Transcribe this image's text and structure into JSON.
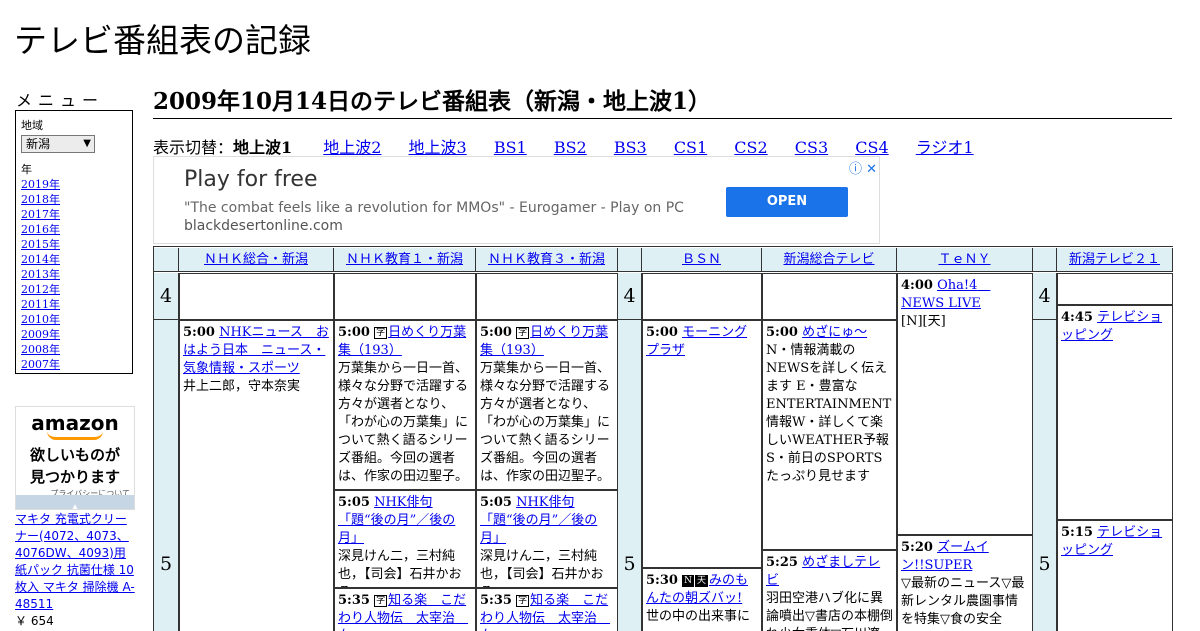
{
  "site_title": "テレビ番組表の記録",
  "menu": {
    "title": "メニュー",
    "region_label": "地域",
    "region_value": "新潟",
    "year_label": "年",
    "years": [
      "2019年",
      "2018年",
      "2017年",
      "2016年",
      "2015年",
      "2014年",
      "2013年",
      "2012年",
      "2011年",
      "2010年",
      "2009年",
      "2008年",
      "2007年"
    ]
  },
  "amazon_ad": {
    "logo": "amazon",
    "tagline_1": "欲しいものが",
    "tagline_2": "見つかります",
    "privacy": "プライバシーについて"
  },
  "product": {
    "text": "マキタ 充電式クリーナー(4072、4073、4076DW、4093)用 紙パック 抗菌仕様 10枚入 マキタ 掃除機 A-48511",
    "price": "￥ 654"
  },
  "page_heading": "2009年10月14日のテレビ番組表（新潟・地上波1）",
  "switcher": {
    "label": "表示切替：",
    "current": "地上波1",
    "links": [
      "地上波2",
      "地上波3",
      "BS1",
      "BS2",
      "BS3",
      "CS1",
      "CS2",
      "CS3",
      "CS4",
      "ラジオ1"
    ]
  },
  "ad": {
    "headline": "Play for free",
    "desc": "\"The combat feels like a revolution for MMOs\" - Eurogamer - Play on PC",
    "url": "blackdesertonline.com",
    "button": "OPEN",
    "icons": "ⓘ ✕"
  },
  "channels": [
    "ＮＨＫ総合・新潟",
    "ＮＨＫ教育１・新潟",
    "ＮＨＫ教育３・新潟",
    "ＢＳＮ",
    "新潟総合テレビ",
    "ＴｅＮＹ",
    "新潟テレビ２１"
  ],
  "hours": {
    "h4": "4",
    "h5": "5"
  },
  "programs": {
    "nhk_500": {
      "time": "5:00",
      "title": "NHKニュース　おはよう日本　ニュース・気象情報・スポーツ",
      "desc": "井上二郎，守本奈実"
    },
    "e1_500": {
      "time": "5:00",
      "badge": "字",
      "title": "日めくり万葉集（193）",
      "desc": "万葉集から一日一首、様々な分野で活躍する方々が選者となり、「わが心の万葉集」について熱く語るシリーズ番組。今回の選者は、作家の田辺聖子。"
    },
    "e1_505": {
      "time": "5:05",
      "title": "NHK俳句「題“後の月”／後の月」",
      "desc": "深見けん二，三村純也，【司会】石井かおる"
    },
    "e1_535": {
      "time": "5:35",
      "badge": "字",
      "title": "知る楽　こだわり人物伝　太宰治　女"
    },
    "e3_500": {
      "time": "5:00",
      "badge": "字",
      "title": "日めくり万葉集（193）",
      "desc": "万葉集から一日一首、様々な分野で活躍する方々が選者となり、「わが心の万葉集」について熱く語るシリーズ番組。今回の選者は、作家の田辺聖子。"
    },
    "e3_505": {
      "time": "5:05",
      "title": "NHK俳句「題“後の月”／後の月」",
      "desc": "深見けん二，三村純也，【司会】石井かおる"
    },
    "e3_535": {
      "time": "5:35",
      "badge": "字",
      "title": "知る楽　こだわり人物伝　太宰治　女"
    },
    "bsn_500": {
      "time": "5:00",
      "title": "モーニングプラザ"
    },
    "bsn_530": {
      "time": "5:30",
      "badge1": "N",
      "badge2": "天",
      "title": "みのもんたの朝ズバッ!",
      "desc": "世の中の出来事に"
    },
    "nst_500": {
      "time": "5:00",
      "title": "めざにゅ～",
      "desc": "N・情報満載のNEWSを詳しく伝えます E・豊富なENTERTAINMENT情報W・詳しくて楽しいWEATHER予報 S・前日のSPORTSたっぷり見せます"
    },
    "nst_525": {
      "time": "5:25",
      "title": "めざましテレビ",
      "desc": "羽田空港ハブ化に異論噴出▽書店の本棚倒れ少女重体▽石川遼"
    },
    "teny_400": {
      "time": "4:00",
      "title": "Oha!4　NEWS LIVE",
      "desc": "[N][天]"
    },
    "teny_520": {
      "time": "5:20",
      "title": "ズームイン!!SUPER",
      "desc": "▽最新のニュース▽最新レンタル農園事情を特集▽食の安全"
    },
    "ux_445": {
      "time": "4:45",
      "title": "テレビショッピング"
    },
    "ux_515": {
      "time": "5:15",
      "title": "テレビショッピング"
    }
  }
}
